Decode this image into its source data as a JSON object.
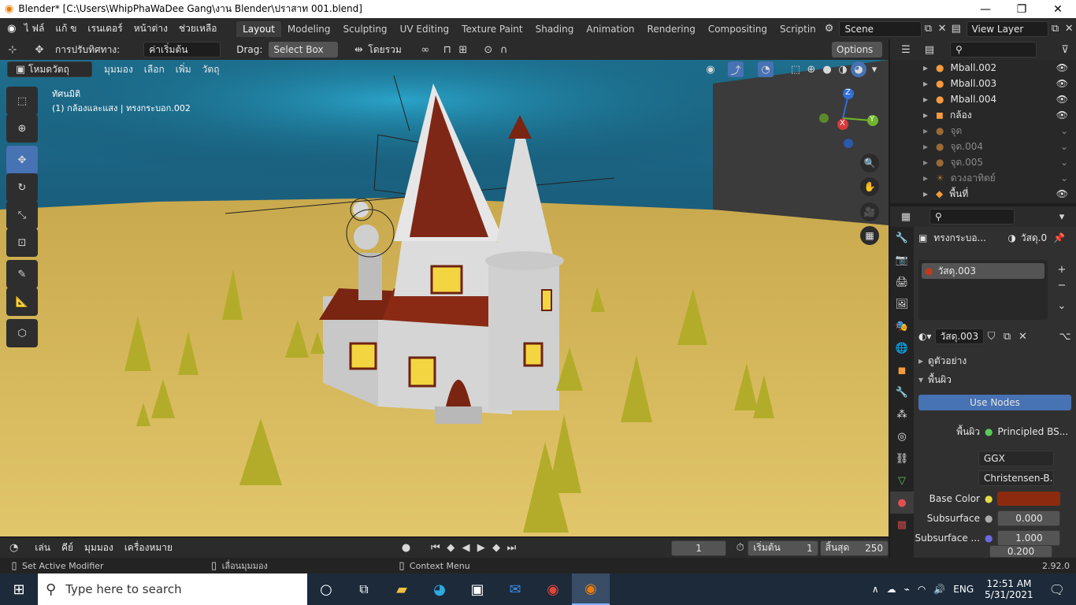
{
  "window": {
    "title": "Blender* [C:\\Users\\WhipPhaWaDee Gang\\งาน Blender\\ปราสาท 001.blend]",
    "minimize": "—",
    "maximize": "❐",
    "close": "✕"
  },
  "menu": [
    "ไ ฟล์",
    "แก้ ข",
    "เรนเดอร์",
    "หน้าต่าง",
    "ช่วยเหลือ"
  ],
  "workspaces": [
    "Layout",
    "Modeling",
    "Sculpting",
    "UV Editing",
    "Texture Paint",
    "Shading",
    "Animation",
    "Rendering",
    "Compositing",
    "Scriptin"
  ],
  "active_workspace": "Layout",
  "scene": {
    "label": "Scene",
    "view_layer": "View Layer"
  },
  "header2": {
    "transform_label": "การปรับทิศทาง:",
    "orientation": "ค่าเริ่มต้น",
    "drag_label": "Drag:",
    "drag_value": "Select Box",
    "pivot": "โดยรวม",
    "options": "Options"
  },
  "viewport_header": {
    "mode": "โหมดวัตถุ",
    "menus": [
      "มุมมอง",
      "เลือก",
      "เพิ่ม",
      "วัตถุ"
    ]
  },
  "viewport": {
    "view_name": "ทัศนมิติ",
    "info": "(1) กล้องและแสง | ทรงกระบอก.002"
  },
  "gizmo": {
    "x": "X",
    "y": "Y",
    "z": "Z"
  },
  "outliner": {
    "search_placeholder": "",
    "rows": [
      {
        "name": "Mball.002",
        "dim": false
      },
      {
        "name": "Mball.003",
        "dim": false
      },
      {
        "name": "Mball.004",
        "dim": false
      },
      {
        "name": "กล้อง",
        "dim": false
      },
      {
        "name": "จุด",
        "dim": true
      },
      {
        "name": "จุด.004",
        "dim": true
      },
      {
        "name": "จุด.005",
        "dim": true
      },
      {
        "name": "ดวงอาทิตย์",
        "dim": true
      },
      {
        "name": "พื้นที่",
        "dim": false
      }
    ]
  },
  "properties": {
    "object_name": "ทรงกระบอ...",
    "material_slot_name": "วัสดุ.0",
    "material_list_item": "วัสดุ.003",
    "material_field": "วัสดุ.003",
    "preview_label": "ดูตัวอย่าง",
    "surface_label": "พื้นผิว",
    "use_nodes": "Use Nodes",
    "surface_field_label": "พื้นผิว",
    "surface_shader": "Principled BS...",
    "distribution": "GGX",
    "subsurface_method": "Christensen-B...",
    "base_color_label": "Base Color",
    "base_color": "#8b2a0e",
    "subsurface_label": "Subsurface",
    "subsurface_value": "0.000",
    "subsurface2_label": "Subsurface ...",
    "subsurface2_values": [
      "1.000",
      "0.200"
    ]
  },
  "timeline": {
    "menus": [
      "เล่น",
      "คีย์",
      "มุมมอง",
      "เครื่องหมาย"
    ],
    "current_frame": "1",
    "start_label": "เริ่มต้น",
    "start": "1",
    "end_label": "สิ้นสุด",
    "end": "250"
  },
  "statusbar": {
    "left": "Set Active Modifier",
    "mid": "เลื่อนมุมมอง",
    "right": "Context Menu",
    "version": "2.92.0"
  },
  "taskbar": {
    "search_placeholder": "Type here to search",
    "lang": "ENG",
    "time": "12:51 AM",
    "date": "5/31/2021"
  }
}
